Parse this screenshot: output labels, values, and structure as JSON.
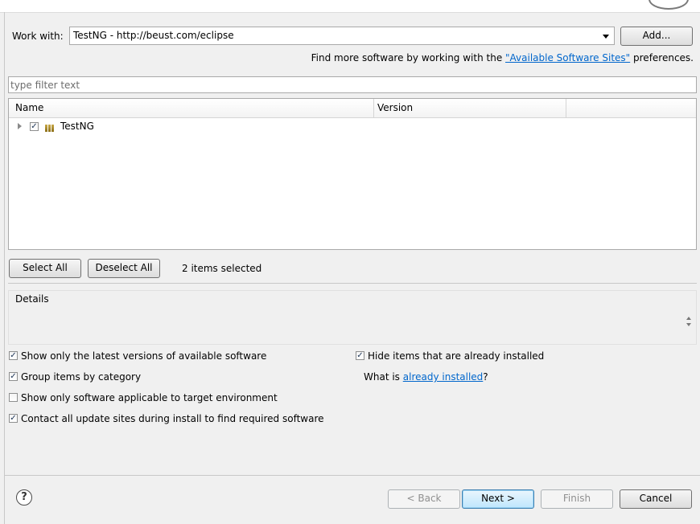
{
  "work_with": {
    "label": "Work with:",
    "value": "TestNG - http://beust.com/eclipse",
    "add_button": "Add..."
  },
  "find_more": {
    "prefix": "Find more software by working with the ",
    "link": "\"Available Software Sites\"",
    "suffix": " preferences."
  },
  "filter": {
    "placeholder": "type filter text"
  },
  "table": {
    "columns": [
      "Name",
      "Version"
    ],
    "rows": [
      {
        "name": "TestNG",
        "version": "",
        "checked": true,
        "expandable": true
      }
    ]
  },
  "selection": {
    "select_all": "Select All",
    "deselect_all": "Deselect All",
    "status": "2 items selected"
  },
  "details": {
    "title": "Details"
  },
  "options": {
    "latest_versions": {
      "label": "Show only the latest versions of available software",
      "checked": true
    },
    "group_by_category": {
      "label": "Group items by category",
      "checked": true
    },
    "target_env": {
      "label": "Show only software applicable to target environment",
      "checked": false
    },
    "contact_sites": {
      "label": "Contact all update sites during install to find required software",
      "checked": true
    },
    "hide_installed": {
      "label": "Hide items that are already installed",
      "checked": true
    },
    "what_is": {
      "prefix": "What is ",
      "link": "already installed",
      "suffix": "?"
    }
  },
  "footer": {
    "help_icon": "?",
    "back": "< Back",
    "next": "Next >",
    "finish": "Finish",
    "cancel": "Cancel"
  },
  "colors": {
    "link": "#0066cc",
    "default_button_border": "#3c7fb1"
  }
}
